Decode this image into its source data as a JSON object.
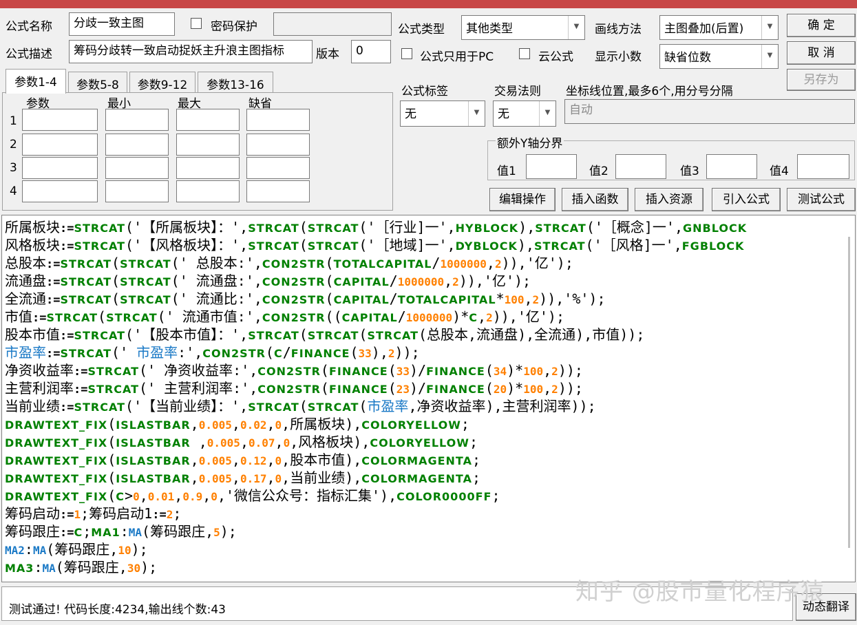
{
  "titlebar": {
    "color": "#c84848"
  },
  "form": {
    "name_label": "公式名称",
    "name_value": "分歧一致主图",
    "password_label": "密码保护",
    "desc_label": "公式描述",
    "desc_value": "筹码分歧转一致启动捉妖主升浪主图指标",
    "version_label": "版本",
    "version_value": "0",
    "type_label": "公式类型",
    "type_value": "其他类型",
    "draw_label": "画线方法",
    "draw_value": "主图叠加(后置)",
    "pc_only_label": "公式只用于PC",
    "cloud_label": "云公式",
    "decimals_label": "显示小数",
    "decimals_value": "缺省位数",
    "tag_label": "公式标签",
    "tag_value": "无",
    "trade_label": "交易法则",
    "trade_value": "无",
    "coord_label": "坐标线位置,最多6个,用分号分隔",
    "coord_placeholder": "自动",
    "yaxis_group": "额外Y轴分界",
    "val1": "值1",
    "val2": "值2",
    "val3": "值3",
    "val4": "值4"
  },
  "buttons": {
    "ok": "确  定",
    "cancel": "取  消",
    "save_as": "另存为",
    "edit_op": "编辑操作",
    "insert_func": "插入函数",
    "insert_res": "插入资源",
    "import_formula": "引入公式",
    "test_formula": "测试公式",
    "dyn_translate": "动态翻译"
  },
  "tabs": [
    "参数1-4",
    "参数5-8",
    "参数9-12",
    "参数13-16"
  ],
  "param_headers": [
    "参数",
    "最小",
    "最大",
    "缺省"
  ],
  "param_rows": [
    "1",
    "2",
    "3",
    "4"
  ],
  "code_lines": [
    [
      [
        "t",
        "所属板块"
      ],
      [
        "o",
        ":="
      ],
      [
        "k",
        "STRCAT"
      ],
      [
        "t",
        "('【所属板块】：',"
      ],
      [
        "k",
        "STRCAT"
      ],
      [
        "t",
        "("
      ],
      [
        "k",
        "STRCAT"
      ],
      [
        "t",
        "('［行业]一',"
      ],
      [
        "k",
        "HYBLOCK"
      ],
      [
        "t",
        "),"
      ],
      [
        "k",
        "STRCAT"
      ],
      [
        "t",
        "('［概念]一',"
      ],
      [
        "k",
        "GNBLOCK"
      ]
    ],
    [
      [
        "t",
        "风格板块"
      ],
      [
        "o",
        ":="
      ],
      [
        "k",
        "STRCAT"
      ],
      [
        "t",
        "('【风格板块】：',"
      ],
      [
        "k",
        "STRCAT"
      ],
      [
        "t",
        "("
      ],
      [
        "k",
        "STRCAT"
      ],
      [
        "t",
        "('［地域]一',"
      ],
      [
        "k",
        "DYBLOCK"
      ],
      [
        "t",
        "),"
      ],
      [
        "k",
        "STRCAT"
      ],
      [
        "t",
        "('［风格]一',"
      ],
      [
        "k",
        "FGBLOCK"
      ]
    ],
    [
      [
        "t",
        "总股本"
      ],
      [
        "o",
        ":="
      ],
      [
        "k",
        "STRCAT"
      ],
      [
        "t",
        "("
      ],
      [
        "k",
        "STRCAT"
      ],
      [
        "t",
        "(' 总股本:',"
      ],
      [
        "k",
        "CON2STR"
      ],
      [
        "t",
        "("
      ],
      [
        "k",
        "TOTALCAPITAL"
      ],
      [
        "t",
        "/"
      ],
      [
        "n",
        "1000000"
      ],
      [
        "t",
        ","
      ],
      [
        "n",
        "2"
      ],
      [
        "t",
        ")),'亿');"
      ]
    ],
    [
      [
        "t",
        "流通盘"
      ],
      [
        "o",
        ":="
      ],
      [
        "k",
        "STRCAT"
      ],
      [
        "t",
        "("
      ],
      [
        "k",
        "STRCAT"
      ],
      [
        "t",
        "(' 流通盘:',"
      ],
      [
        "k",
        "CON2STR"
      ],
      [
        "t",
        "("
      ],
      [
        "k",
        "CAPITAL"
      ],
      [
        "t",
        "/"
      ],
      [
        "n",
        "1000000"
      ],
      [
        "t",
        ","
      ],
      [
        "n",
        "2"
      ],
      [
        "t",
        ")),'亿');"
      ]
    ],
    [
      [
        "t",
        "全流通"
      ],
      [
        "o",
        ":="
      ],
      [
        "k",
        "STRCAT"
      ],
      [
        "t",
        "("
      ],
      [
        "k",
        "STRCAT"
      ],
      [
        "t",
        "(' 流通比:',"
      ],
      [
        "k",
        "CON2STR"
      ],
      [
        "t",
        "("
      ],
      [
        "k",
        "CAPITAL"
      ],
      [
        "t",
        "/"
      ],
      [
        "k",
        "TOTALCAPITAL"
      ],
      [
        "t",
        "*"
      ],
      [
        "n",
        "100"
      ],
      [
        "t",
        ","
      ],
      [
        "n",
        "2"
      ],
      [
        "t",
        ")),'%');"
      ]
    ],
    [
      [
        "t",
        "市值"
      ],
      [
        "o",
        ":="
      ],
      [
        "k",
        "STRCAT"
      ],
      [
        "t",
        "("
      ],
      [
        "k",
        "STRCAT"
      ],
      [
        "t",
        "(' 流通市值:',"
      ],
      [
        "k",
        "CON2STR"
      ],
      [
        "t",
        "(("
      ],
      [
        "k",
        "CAPITAL"
      ],
      [
        "t",
        "/"
      ],
      [
        "n",
        "1000000"
      ],
      [
        "t",
        ")*"
      ],
      [
        "k",
        "C"
      ],
      [
        "t",
        ","
      ],
      [
        "n",
        "2"
      ],
      [
        "t",
        ")),'亿');"
      ]
    ],
    [
      [
        "t",
        "股本市值"
      ],
      [
        "o",
        ":="
      ],
      [
        "k",
        "STRCAT"
      ],
      [
        "t",
        "('【股本市值】：',"
      ],
      [
        "k",
        "STRCAT"
      ],
      [
        "t",
        "("
      ],
      [
        "k",
        "STRCAT"
      ],
      [
        "t",
        "("
      ],
      [
        "k",
        "STRCAT"
      ],
      [
        "t",
        "(总股本,流通盘),全流通),市值));"
      ]
    ],
    [
      [
        "b",
        "市盈率"
      ],
      [
        "o",
        ":="
      ],
      [
        "k",
        "STRCAT"
      ],
      [
        "t",
        "(' "
      ],
      [
        "b",
        "市盈率"
      ],
      [
        "t",
        ":',"
      ],
      [
        "k",
        "CON2STR"
      ],
      [
        "t",
        "("
      ],
      [
        "k",
        "C"
      ],
      [
        "t",
        "/"
      ],
      [
        "k",
        "FINANCE"
      ],
      [
        "t",
        "("
      ],
      [
        "n",
        "33"
      ],
      [
        "t",
        "),"
      ],
      [
        "n",
        "2"
      ],
      [
        "t",
        "));"
      ]
    ],
    [
      [
        "t",
        "净资收益率"
      ],
      [
        "o",
        ":="
      ],
      [
        "k",
        "STRCAT"
      ],
      [
        "t",
        "(' 净资收益率:',"
      ],
      [
        "k",
        "CON2STR"
      ],
      [
        "t",
        "("
      ],
      [
        "k",
        "FINANCE"
      ],
      [
        "t",
        "("
      ],
      [
        "n",
        "33"
      ],
      [
        "t",
        ")/"
      ],
      [
        "k",
        "FINANCE"
      ],
      [
        "t",
        "("
      ],
      [
        "n",
        "34"
      ],
      [
        "t",
        ")*"
      ],
      [
        "n",
        "100"
      ],
      [
        "t",
        ","
      ],
      [
        "n",
        "2"
      ],
      [
        "t",
        "));"
      ]
    ],
    [
      [
        "t",
        "主营利润率"
      ],
      [
        "o",
        ":="
      ],
      [
        "k",
        "STRCAT"
      ],
      [
        "t",
        "(' 主营利润率:',"
      ],
      [
        "k",
        "CON2STR"
      ],
      [
        "t",
        "("
      ],
      [
        "k",
        "FINANCE"
      ],
      [
        "t",
        "("
      ],
      [
        "n",
        "23"
      ],
      [
        "t",
        ")/"
      ],
      [
        "k",
        "FINANCE"
      ],
      [
        "t",
        "("
      ],
      [
        "n",
        "20"
      ],
      [
        "t",
        ")*"
      ],
      [
        "n",
        "100"
      ],
      [
        "t",
        ","
      ],
      [
        "n",
        "2"
      ],
      [
        "t",
        "));"
      ]
    ],
    [
      [
        "t",
        "当前业绩"
      ],
      [
        "o",
        ":="
      ],
      [
        "k",
        "STRCAT"
      ],
      [
        "t",
        "('【当前业绩】：',"
      ],
      [
        "k",
        "STRCAT"
      ],
      [
        "t",
        "("
      ],
      [
        "k",
        "STRCAT"
      ],
      [
        "t",
        "("
      ],
      [
        "b",
        "市盈率"
      ],
      [
        "t",
        ",净资收益率),主营利润率));"
      ]
    ],
    [
      [
        "k",
        "DRAWTEXT_FIX"
      ],
      [
        "t",
        "("
      ],
      [
        "k",
        "ISLASTBAR"
      ],
      [
        "t",
        ","
      ],
      [
        "n",
        "0.005"
      ],
      [
        "t",
        ","
      ],
      [
        "n",
        "0.02"
      ],
      [
        "t",
        ","
      ],
      [
        "n",
        "0"
      ],
      [
        "t",
        ",所属板块),"
      ],
      [
        "k",
        "COLORYELLOW"
      ],
      [
        "t",
        ";"
      ]
    ],
    [
      [
        "k",
        "DRAWTEXT_FIX"
      ],
      [
        "t",
        "("
      ],
      [
        "k",
        "ISLASTBAR"
      ],
      [
        "t",
        " ,"
      ],
      [
        "n",
        "0.005"
      ],
      [
        "t",
        ","
      ],
      [
        "n",
        "0.07"
      ],
      [
        "t",
        ","
      ],
      [
        "n",
        "0"
      ],
      [
        "t",
        ",风格板块),"
      ],
      [
        "k",
        "COLORYELLOW"
      ],
      [
        "t",
        ";"
      ]
    ],
    [
      [
        "k",
        "DRAWTEXT_FIX"
      ],
      [
        "t",
        "("
      ],
      [
        "k",
        "ISLASTBAR"
      ],
      [
        "t",
        ","
      ],
      [
        "n",
        "0.005"
      ],
      [
        "t",
        ","
      ],
      [
        "n",
        "0.12"
      ],
      [
        "t",
        ","
      ],
      [
        "n",
        "0"
      ],
      [
        "t",
        ",股本市值),"
      ],
      [
        "k",
        "COLORMAGENTA"
      ],
      [
        "t",
        ";"
      ]
    ],
    [
      [
        "k",
        "DRAWTEXT_FIX"
      ],
      [
        "t",
        "("
      ],
      [
        "k",
        "ISLASTBAR"
      ],
      [
        "t",
        ","
      ],
      [
        "n",
        "0.005"
      ],
      [
        "t",
        ","
      ],
      [
        "n",
        "0.17"
      ],
      [
        "t",
        ","
      ],
      [
        "n",
        "0"
      ],
      [
        "t",
        ",当前业绩),"
      ],
      [
        "k",
        "COLORMAGENTA"
      ],
      [
        "t",
        ";"
      ]
    ],
    [
      [
        "k",
        "DRAWTEXT_FIX"
      ],
      [
        "t",
        "("
      ],
      [
        "k",
        "C"
      ],
      [
        "t",
        ">"
      ],
      [
        "n",
        "0"
      ],
      [
        "t",
        ","
      ],
      [
        "n",
        "0.01"
      ],
      [
        "t",
        ","
      ],
      [
        "n",
        "0.9"
      ],
      [
        "t",
        ","
      ],
      [
        "n",
        "0"
      ],
      [
        "t",
        ",'微信公众号：指标汇集'),"
      ],
      [
        "k",
        "COLOR0000FF"
      ],
      [
        "t",
        ";"
      ]
    ],
    [
      [
        "t",
        "筹码启动"
      ],
      [
        "o",
        ":="
      ],
      [
        "n",
        "1"
      ],
      [
        "t",
        ";筹码启动1"
      ],
      [
        "o",
        ":="
      ],
      [
        "n",
        "2"
      ],
      [
        "t",
        ";"
      ]
    ],
    [
      [
        "t",
        "筹码跟庄"
      ],
      [
        "o",
        ":="
      ],
      [
        "k",
        "C"
      ],
      [
        "t",
        ";"
      ],
      [
        "k",
        "MA1"
      ],
      [
        "t",
        ":"
      ],
      [
        "m",
        "MA"
      ],
      [
        "t",
        "(筹码跟庄,"
      ],
      [
        "n",
        "5"
      ],
      [
        "t",
        ");"
      ]
    ],
    [
      [
        "m",
        "MA2"
      ],
      [
        "t",
        ":"
      ],
      [
        "m",
        "MA"
      ],
      [
        "t",
        "(筹码跟庄,"
      ],
      [
        "n",
        "10"
      ],
      [
        "t",
        ");"
      ]
    ],
    [
      [
        "k",
        "MA3"
      ],
      [
        "t",
        ":"
      ],
      [
        "m",
        "MA"
      ],
      [
        "t",
        "(筹码跟庄,"
      ],
      [
        "n",
        "30"
      ],
      [
        "t",
        ");"
      ]
    ]
  ],
  "status": "测试通过! 代码长度:4234,输出线个数:43",
  "watermark": "知乎 @股市量化程序猿"
}
